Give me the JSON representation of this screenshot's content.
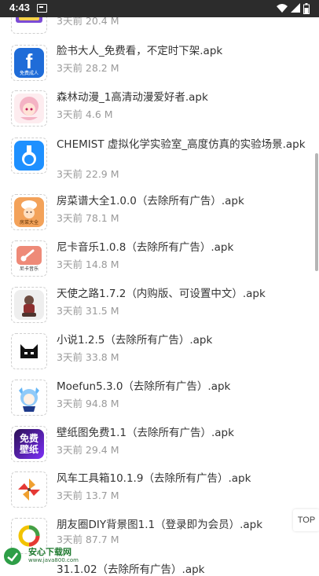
{
  "status_bar": {
    "time": "4:43"
  },
  "items": [
    {
      "title": "",
      "meta": "3天前  20.4 M",
      "icon": "purple-banner-app-icon",
      "color": "#7b4bd6"
    },
    {
      "title": "脸书大人_免费看，不定时下架.apk",
      "meta": "3天前  28.2 M",
      "icon": "facebook-app-icon",
      "color": "#1f6cd8"
    },
    {
      "title": "森林动漫_1高清动漫爱好者.apk",
      "meta": "3天前  4.6 M",
      "icon": "anime-girl-app-icon",
      "color": "#f2b6c8"
    },
    {
      "title": "CHEMIST 虚拟化学实验室_高度仿真的实验场景.apk",
      "meta": "3天前  22.9 M",
      "icon": "flask-app-icon",
      "color": "#1e90ff"
    },
    {
      "title": "房菜谱大全1.0.0（去除所有广告）.apk",
      "meta": "3天前  78.1 M",
      "icon": "chef-app-icon",
      "color": "#f3a25a"
    },
    {
      "title": "尼卡音乐1.0.8（去除所有广告）.apk",
      "meta": "3天前  14.8 M",
      "icon": "music-app-icon",
      "color": "#e57373"
    },
    {
      "title": "天使之路1.7.2（内购版、可设置中文）.apk",
      "meta": "3天前  31.5 M",
      "icon": "game-character-app-icon",
      "color": "#8d6e63"
    },
    {
      "title": "小说1.2.5（去除所有广告）.apk",
      "meta": "3天前  33.8 M",
      "icon": "cat-face-app-icon",
      "color": "#000000"
    },
    {
      "title": "Moefun5.3.0（去除所有广告）.apk",
      "meta": "3天前  94.8 M",
      "icon": "moe-girl-app-icon",
      "color": "#90caf9"
    },
    {
      "title": "壁纸图免费1.1（去除所有广告）.apk",
      "meta": "3天前  29.4 M",
      "icon": "wallpaper-app-icon",
      "color": "#3b1f8f"
    },
    {
      "title": "风车工具箱10.1.9（去除所有广告）.apk",
      "meta": "3天前  13.7 M",
      "icon": "pinwheel-app-icon",
      "color": "#f0a030"
    },
    {
      "title": "朋友圈DIY背景图1.1（登录即为会员）.apk",
      "meta": "3天前  87.7 M",
      "icon": "ring-app-icon",
      "color": "#f2c300"
    }
  ],
  "partial_item": "31.1.02（去除所有广告）.apk",
  "top_button": "TOP",
  "watermark": {
    "name": "安心下载网",
    "url": "www.java800.com"
  },
  "icon_texts": {
    "facebook_caption": "免费成人",
    "chef_caption": "房菜大全",
    "music_caption": "尼卡音乐",
    "wallpaper_line1": "免费",
    "wallpaper_line2": "壁纸"
  }
}
